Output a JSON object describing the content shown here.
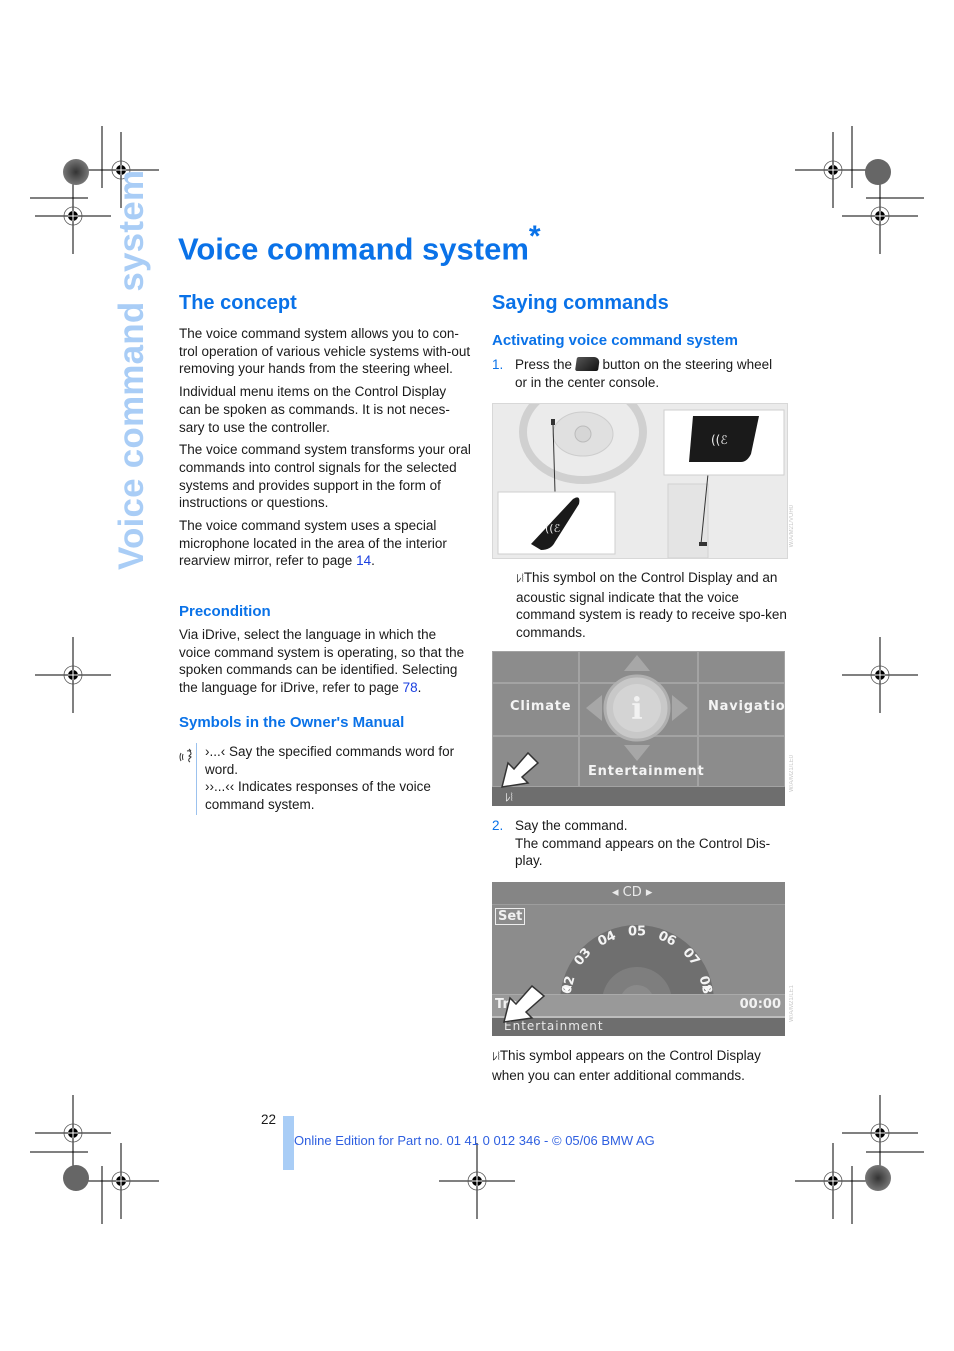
{
  "side_title": "Voice command system",
  "page_title": "Voice command system",
  "page_title_mark": "*",
  "left_column": {
    "concept": {
      "heading": "The concept",
      "paragraphs": [
        "The voice command system allows you to con-trol operation of various vehicle systems with-out removing your hands from the steering wheel.",
        "Individual menu items on the Control Display can be spoken as commands. It is not neces-sary to use the controller.",
        "The voice command system transforms your oral commands into control signals for the selected systems and provides support in the form of instructions or questions."
      ],
      "mic_paragraph_prefix": "The voice command system uses a special microphone located in the area of the interior rearview mirror, refer to page ",
      "mic_paragraph_link": "14",
      "mic_paragraph_suffix": "."
    },
    "precondition": {
      "heading": "Precondition",
      "text_prefix": "Via iDrive, select the language in which the voice command system is operating, so that the spoken commands can be identified. Selecting the language for iDrive, refer to page ",
      "link": "78",
      "text_suffix": "."
    },
    "symbols": {
      "heading": "Symbols in the Owner's Manual",
      "icon": "voice-command-icon",
      "line1_marks": "›...‹",
      "line1_text": " Say the specified commands word for word.",
      "line2_marks": "››...‹‹",
      "line2_text": " Indicates responses of the voice command system."
    }
  },
  "right_column": {
    "heading": "Saying commands",
    "subheading": "Activating voice command system",
    "steps": [
      {
        "num": "1.",
        "text_before": "Press the ",
        "icon": "voice-button-icon",
        "text_after": " button on the steering wheel or in the center console."
      },
      {
        "num": "2.",
        "text": "Say the command.",
        "subtext": "The command appears on the Control Dis-play."
      }
    ],
    "symbol_note_1": "This symbol on the Control Display and an acoustic signal indicate that the voice command system is ready to receive spo-ken commands.",
    "symbol_note_2": "This symbol appears on the Control Display when you can enter additional commands.",
    "figure1": {
      "alt": "Steering wheel and center console with voice command buttons",
      "code": "W/A/M21/VUH0"
    },
    "figure2": {
      "alt": "iDrive start menu",
      "labels": {
        "left": "Climate",
        "right": "Navigation",
        "bottom": "Entertainment"
      },
      "code": "W/A/M21/LE0"
    },
    "figure3": {
      "alt": "CD track selection screen",
      "header": "CD",
      "set_label": "Set",
      "tracks": [
        "02",
        "03",
        "04",
        "05",
        "06",
        "07",
        "08"
      ],
      "track_label": "Tra",
      "time": "00:00",
      "footer": "Entertainment",
      "code": "W/A/M21/LE1"
    }
  },
  "footer": {
    "page_number": "22",
    "edition": "Online Edition for Part no. 01 41 0 012 346 - © 05/06 BMW AG"
  }
}
